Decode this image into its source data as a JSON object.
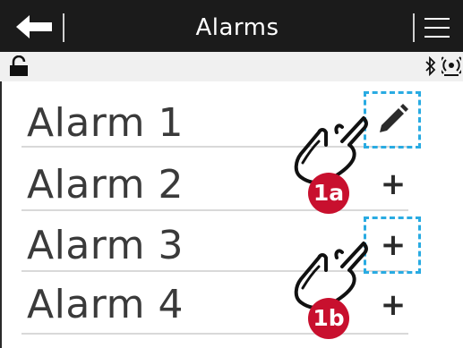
{
  "header": {
    "title": "Alarms",
    "back_icon": "back-arrow-icon",
    "menu_icon": "hamburger-menu-icon"
  },
  "statusbar": {
    "lock_icon": "lock-icon",
    "bluetooth_icon": "bluetooth-icon",
    "wireless_icon": "wireless-icon"
  },
  "alarms": [
    {
      "label": "Alarm 1",
      "action": "edit",
      "action_icon": "pencil-icon"
    },
    {
      "label": "Alarm 2",
      "action": "add",
      "action_symbol": "+"
    },
    {
      "label": "Alarm 3",
      "action": "add",
      "action_symbol": "+"
    },
    {
      "label": "Alarm 4",
      "action": "add",
      "action_symbol": "+"
    }
  ],
  "callouts": [
    {
      "label": "1a"
    },
    {
      "label": "1b"
    }
  ],
  "colors": {
    "header_bg": "#1b1b1b",
    "statusbar_bg": "#f0f0f0",
    "highlight": "#29abe2",
    "badge": "#c8102e"
  }
}
